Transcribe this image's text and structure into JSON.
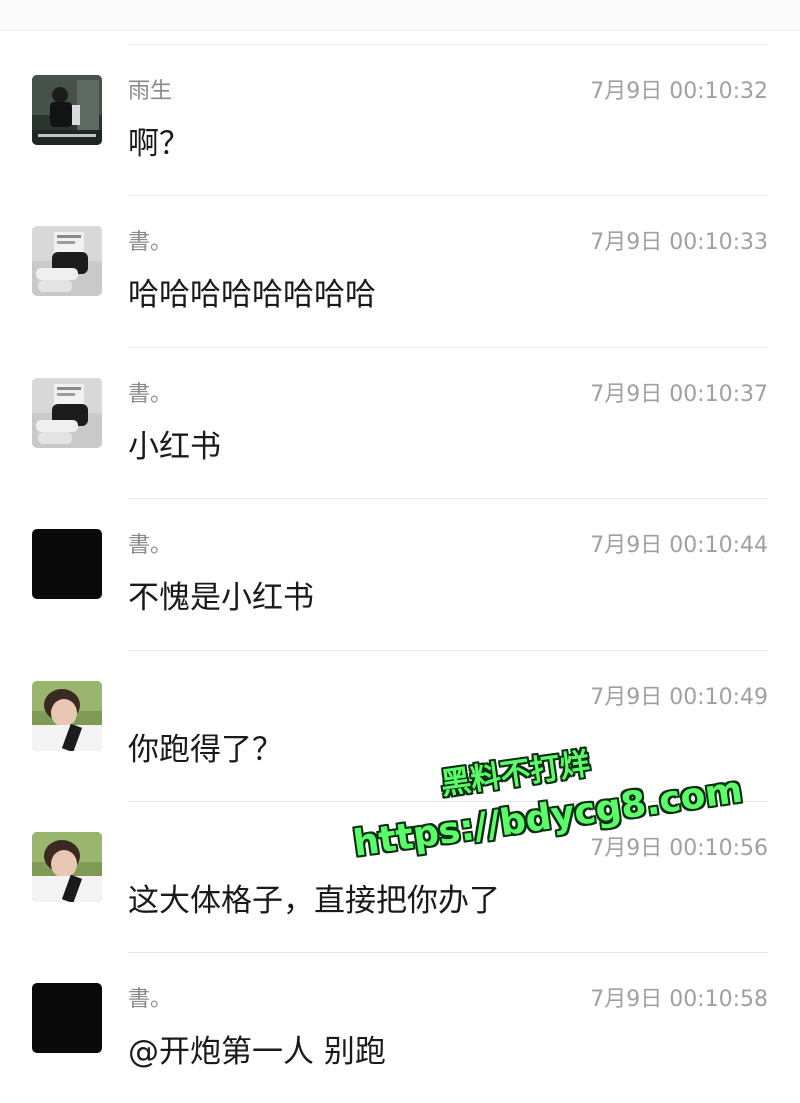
{
  "messages": [
    {
      "sender": "雨生",
      "time": "7月9日 00:10:32",
      "text": "啊？",
      "avatar": "photo-avatar-dark"
    },
    {
      "sender": "書。",
      "time": "7月9日 00:10:33",
      "text": "哈哈哈哈哈哈哈哈",
      "avatar": "photo-avatar-reading"
    },
    {
      "sender": "書。",
      "time": "7月9日 00:10:37",
      "text": "小红书",
      "avatar": "photo-avatar-reading"
    },
    {
      "sender": "書。",
      "time": "7月9日 00:10:44",
      "text": "不愧是小红书",
      "avatar": "black-avatar"
    },
    {
      "sender": "",
      "time": "7月9日 00:10:49",
      "text": "你跑得了？",
      "avatar": "photo-avatar-portrait"
    },
    {
      "sender": "",
      "time": "7月9日 00:10:56",
      "text": "这大体格子，直接把你办了",
      "avatar": "photo-avatar-portrait"
    },
    {
      "sender": "書。",
      "time": "7月9日 00:10:58",
      "text": "@开炮第一人 别跑",
      "avatar": "black-avatar"
    }
  ],
  "watermark": {
    "line1": "黑料不打烊",
    "line2": "https://bdycg8.com"
  }
}
